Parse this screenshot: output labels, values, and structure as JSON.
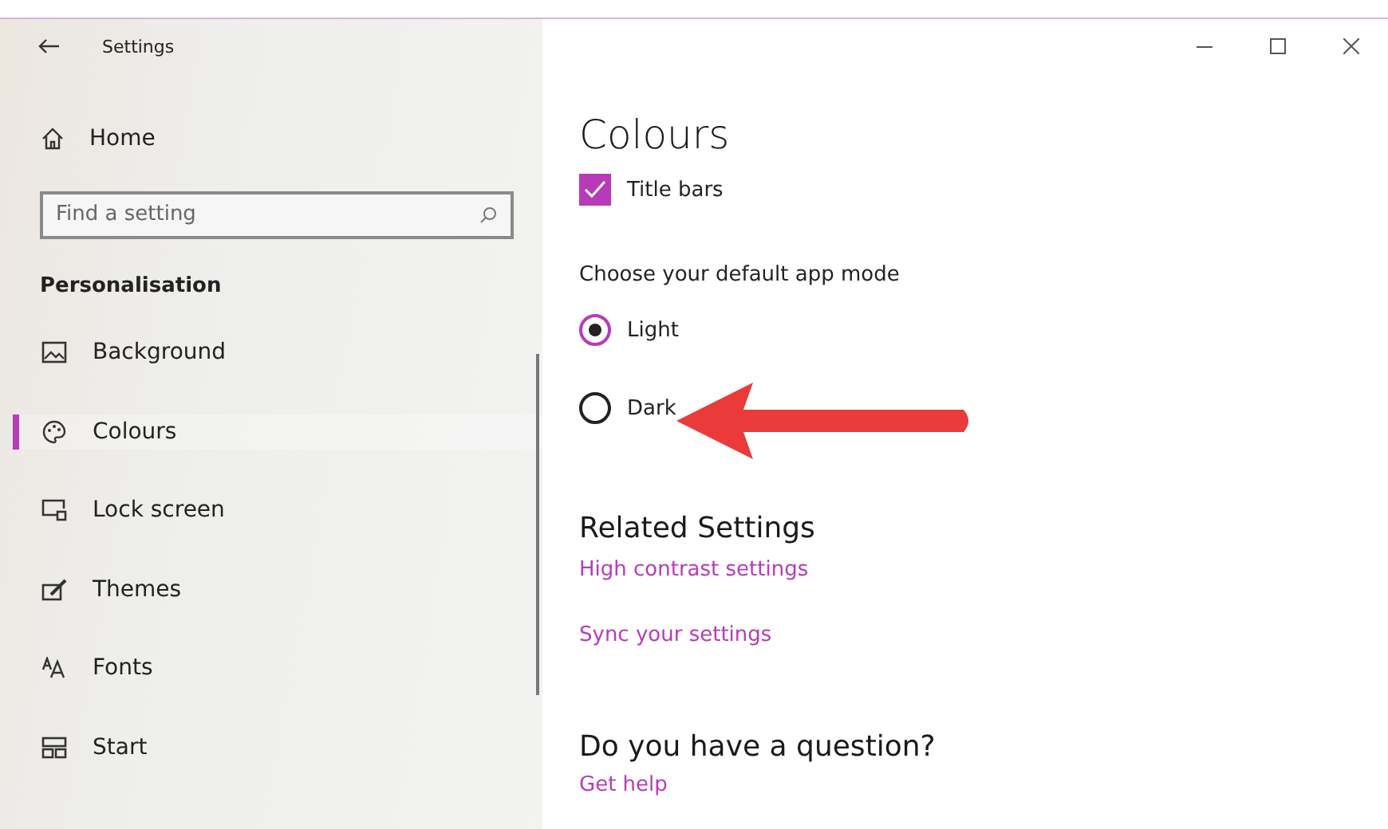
{
  "window": {
    "title": "Settings"
  },
  "sidebar": {
    "home": "Home",
    "search": {
      "placeholder": "Find a setting"
    },
    "section": "Personalisation",
    "items": [
      {
        "label": "Background",
        "selected": false
      },
      {
        "label": "Colours",
        "selected": true
      },
      {
        "label": "Lock screen",
        "selected": false
      },
      {
        "label": "Themes",
        "selected": false
      },
      {
        "label": "Fonts",
        "selected": false
      },
      {
        "label": "Start",
        "selected": false
      }
    ]
  },
  "content": {
    "heading": "Colours",
    "title_bars": {
      "label": "Title bars",
      "checked": true
    },
    "app_mode": {
      "label": "Choose your default app mode",
      "options": [
        {
          "label": "Light",
          "selected": true
        },
        {
          "label": "Dark",
          "selected": false
        }
      ]
    },
    "related": {
      "heading": "Related Settings",
      "links": [
        "High contrast settings",
        "Sync your settings"
      ]
    },
    "question": {
      "heading": "Do you have a question?",
      "link": "Get help"
    }
  }
}
